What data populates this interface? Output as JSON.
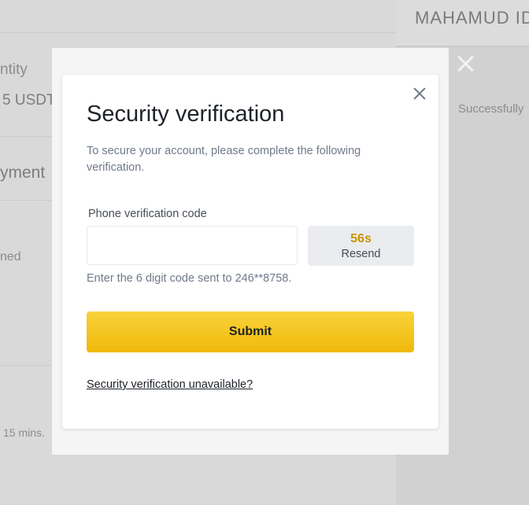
{
  "background": {
    "left_texts": [
      "ntity",
      "5 USDT",
      "yment",
      "ned",
      "15 mins."
    ],
    "right_panel": {
      "title": "MAHAMUD ID",
      "status": "Successfully"
    }
  },
  "modal": {
    "title": "Security verification",
    "description": "To secure your account, please complete the following verification.",
    "field_label": "Phone verification code",
    "input_value": "",
    "input_placeholder": "",
    "resend": {
      "timer": "56s",
      "label": "Resend"
    },
    "hint": "Enter the 6 digit code sent to 246**8758.",
    "submit_label": "Submit",
    "unavailable_link": "Security verification unavailable?",
    "close_icon": "close-icon"
  },
  "colors": {
    "accent": "#F0B90B",
    "timer": "#C99400",
    "text_primary": "#1E2329",
    "text_secondary": "#707A8A"
  }
}
